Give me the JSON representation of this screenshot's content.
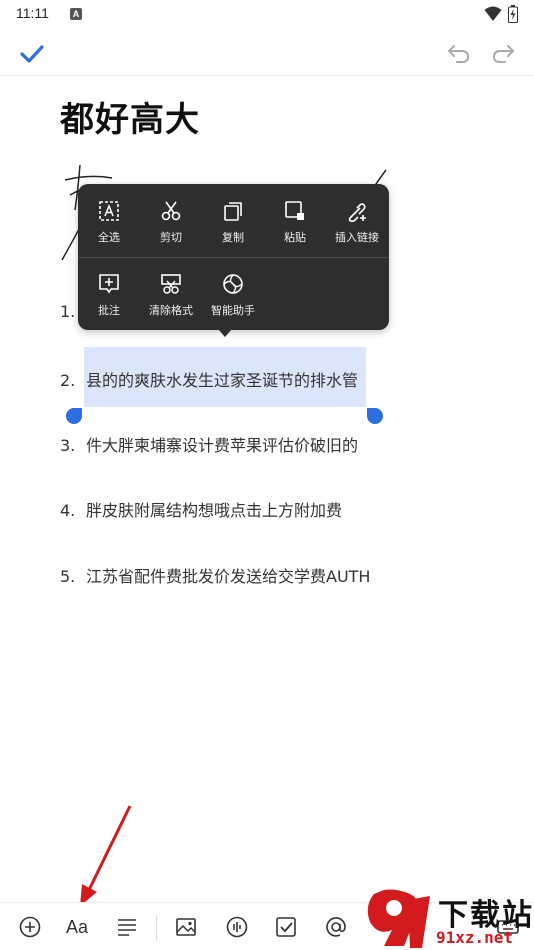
{
  "status_bar": {
    "time": "11:11",
    "badge": "A"
  },
  "document": {
    "title": "都好高大",
    "list": [
      {
        "num": "1.",
        "text": ""
      },
      {
        "num": "2.",
        "text": "县的的爽肤水发生过家圣诞节的排水管"
      },
      {
        "num": "3.",
        "text": "件大胖柬埔寨设计费苹果评估价破旧的"
      },
      {
        "num": "4.",
        "text": "胖皮肤附属结构想哦点击上方附加费"
      },
      {
        "num": "5.",
        "text": "江苏省配件费批发价发送给交学费AUTH"
      }
    ]
  },
  "context_menu": {
    "row1": [
      {
        "label": "全选",
        "icon": "select-all-icon"
      },
      {
        "label": "剪切",
        "icon": "scissors-icon"
      },
      {
        "label": "复制",
        "icon": "copy-icon"
      },
      {
        "label": "粘贴",
        "icon": "paste-icon"
      },
      {
        "label": "插入链接",
        "icon": "link-icon"
      }
    ],
    "row2": [
      {
        "label": "批注",
        "icon": "comment-icon"
      },
      {
        "label": "清除格式",
        "icon": "clear-format-icon"
      },
      {
        "label": "智能助手",
        "icon": "ai-assistant-icon"
      }
    ]
  },
  "toolbar": {
    "font_label": "Aa",
    "icons": [
      "plus-circle-icon",
      "font-icon",
      "align-icon",
      "image-icon",
      "audio-icon",
      "checkbox-icon",
      "mention-icon",
      "keyboard-icon"
    ]
  },
  "watermark": {
    "main": "下载站",
    "sub": "91xz.net"
  },
  "colors": {
    "accent": "#2b6fe0",
    "selection": "#dbe6fb",
    "menu_bg": "#2e2e2e",
    "arrow": "#d21a1f"
  }
}
